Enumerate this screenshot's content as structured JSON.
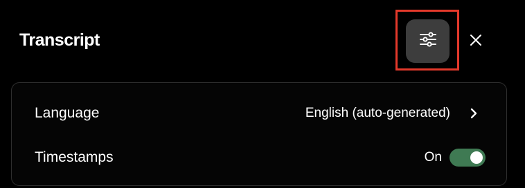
{
  "header": {
    "title": "Transcript",
    "settings_icon": "sliders-icon",
    "close_icon": "close-icon",
    "highlight_color": "#e4392b"
  },
  "settings_menu": {
    "rows": [
      {
        "label": "Language",
        "value": "English (auto-generated)",
        "icon": "chevron-right-icon"
      },
      {
        "label": "Timestamps",
        "value": "On",
        "toggle_on": true,
        "toggle_color": "#3f7a53"
      }
    ]
  }
}
